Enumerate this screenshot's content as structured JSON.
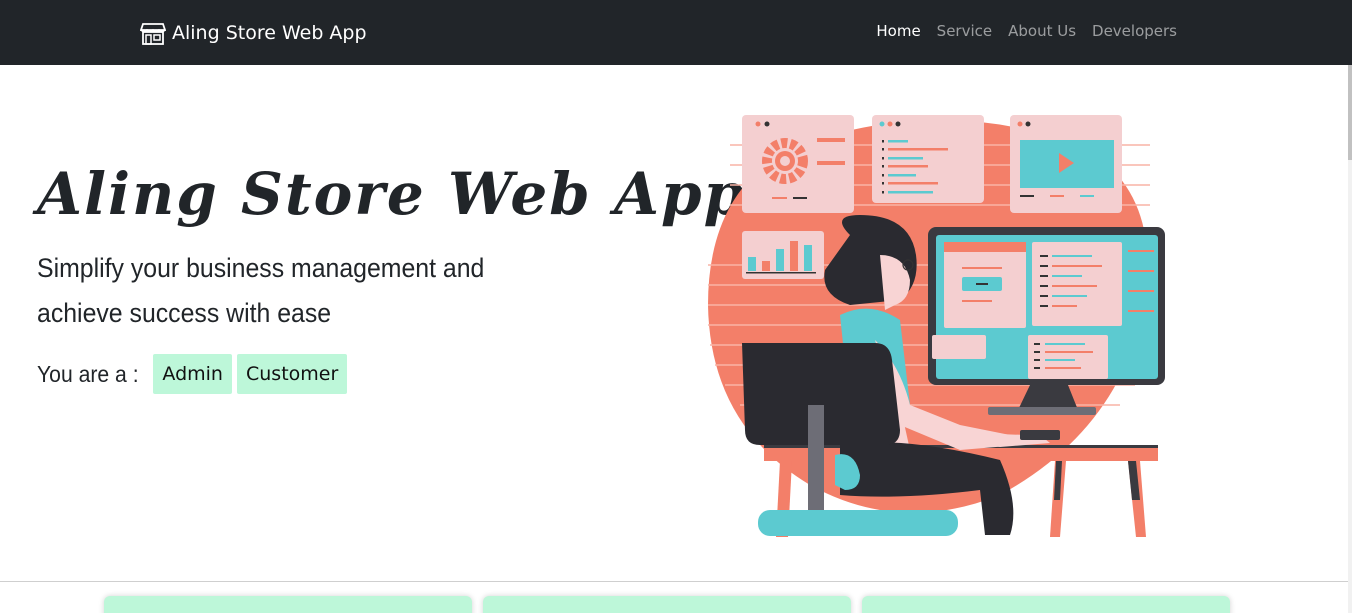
{
  "navbar": {
    "brand": "Aling Store Web App",
    "brand_icon": "store-icon",
    "links": [
      {
        "label": "Home",
        "active": true
      },
      {
        "label": "Service",
        "active": false
      },
      {
        "label": "About Us",
        "active": false
      },
      {
        "label": "Developers",
        "active": false
      }
    ]
  },
  "hero": {
    "title": "Aling Store Web App",
    "subtitle_line1": "Simplify your business management and",
    "subtitle_line2": "achieve success with ease",
    "role_label": "You are a :",
    "roles": [
      "Admin",
      "Customer"
    ]
  },
  "colors": {
    "navbar_bg": "#212529",
    "role_button_bg": "#bdf7d9",
    "illustration_coral": "#f37f69",
    "illustration_teal": "#5ccad0"
  }
}
